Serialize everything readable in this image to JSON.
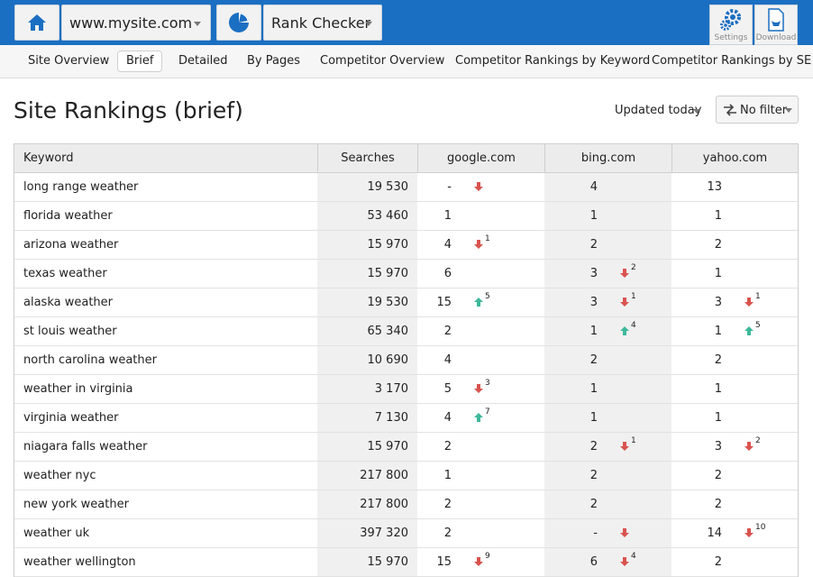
{
  "header": {
    "site": "www.mysite.com",
    "tool": "Rank Checker",
    "settings_label": "Settings",
    "download_label": "Download",
    "colors": {
      "bar": "#1b6fc2",
      "up": "#3db89a",
      "down": "#d9534f"
    }
  },
  "tabs": [
    {
      "label": "Site Overview"
    },
    {
      "label": "Brief",
      "active": true
    },
    {
      "label": "Detailed"
    },
    {
      "label": "By Pages"
    },
    {
      "label": "Competitor Overview"
    },
    {
      "label": "Competitor Rankings by Keyword"
    },
    {
      "label": "Competitor Rankings by SE"
    }
  ],
  "page": {
    "title": "Site Rankings (brief)",
    "updated": "Updated today",
    "filter": "No filter"
  },
  "table": {
    "columns": [
      "Keyword",
      "Searches",
      "google.com",
      "bing.com",
      "yahoo.com"
    ],
    "rows": [
      {
        "keyword": "long range weather",
        "searches": "19 530",
        "google": {
          "rank": "-",
          "dir": "down",
          "delta": ""
        },
        "bing": {
          "rank": "4"
        },
        "yahoo": {
          "rank": "13"
        }
      },
      {
        "keyword": "florida weather",
        "searches": "53 460",
        "google": {
          "rank": "1"
        },
        "bing": {
          "rank": "1"
        },
        "yahoo": {
          "rank": "1"
        }
      },
      {
        "keyword": "arizona weather",
        "searches": "15 970",
        "google": {
          "rank": "4",
          "dir": "down",
          "delta": "1"
        },
        "bing": {
          "rank": "2"
        },
        "yahoo": {
          "rank": "2"
        }
      },
      {
        "keyword": "texas weather",
        "searches": "15 970",
        "google": {
          "rank": "6"
        },
        "bing": {
          "rank": "3",
          "dir": "down",
          "delta": "2"
        },
        "yahoo": {
          "rank": "1"
        }
      },
      {
        "keyword": "alaska weather",
        "searches": "19 530",
        "google": {
          "rank": "15",
          "dir": "up",
          "delta": "5"
        },
        "bing": {
          "rank": "3",
          "dir": "down",
          "delta": "1"
        },
        "yahoo": {
          "rank": "3",
          "dir": "down",
          "delta": "1"
        }
      },
      {
        "keyword": "st louis weather",
        "searches": "65 340",
        "google": {
          "rank": "2"
        },
        "bing": {
          "rank": "1",
          "dir": "up",
          "delta": "4"
        },
        "yahoo": {
          "rank": "1",
          "dir": "up",
          "delta": "5"
        }
      },
      {
        "keyword": "north carolina weather",
        "searches": "10 690",
        "google": {
          "rank": "4"
        },
        "bing": {
          "rank": "2"
        },
        "yahoo": {
          "rank": "2"
        }
      },
      {
        "keyword": "weather in virginia",
        "searches": "3 170",
        "google": {
          "rank": "5",
          "dir": "down",
          "delta": "3"
        },
        "bing": {
          "rank": "1"
        },
        "yahoo": {
          "rank": "1"
        }
      },
      {
        "keyword": "virginia weather",
        "searches": "7 130",
        "google": {
          "rank": "4",
          "dir": "up",
          "delta": "7"
        },
        "bing": {
          "rank": "1"
        },
        "yahoo": {
          "rank": "1"
        }
      },
      {
        "keyword": "niagara falls weather",
        "searches": "15 970",
        "google": {
          "rank": "2"
        },
        "bing": {
          "rank": "2",
          "dir": "down",
          "delta": "1"
        },
        "yahoo": {
          "rank": "3",
          "dir": "down",
          "delta": "2"
        }
      },
      {
        "keyword": "weather nyc",
        "searches": "217 800",
        "google": {
          "rank": "1"
        },
        "bing": {
          "rank": "2"
        },
        "yahoo": {
          "rank": "2"
        }
      },
      {
        "keyword": "new york weather",
        "searches": "217 800",
        "google": {
          "rank": "2"
        },
        "bing": {
          "rank": "2"
        },
        "yahoo": {
          "rank": "2"
        }
      },
      {
        "keyword": "weather uk",
        "searches": "397 320",
        "google": {
          "rank": "2"
        },
        "bing": {
          "rank": "-",
          "dir": "down",
          "delta": ""
        },
        "yahoo": {
          "rank": "14",
          "dir": "down",
          "delta": "10"
        }
      },
      {
        "keyword": "weather wellington",
        "searches": "15 970",
        "google": {
          "rank": "15",
          "dir": "down",
          "delta": "9"
        },
        "bing": {
          "rank": "6",
          "dir": "down",
          "delta": "4"
        },
        "yahoo": {
          "rank": "2"
        }
      }
    ]
  }
}
